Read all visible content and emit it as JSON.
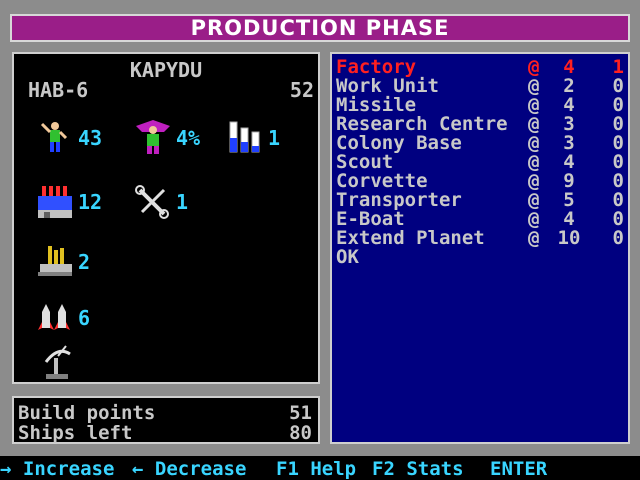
{
  "title": "PRODUCTION PHASE",
  "planet": {
    "name": "KAPYDU",
    "hab": "HAB-6",
    "population": "52",
    "workers": "43",
    "tax": "4%",
    "industry": "1",
    "factories": "12",
    "tools": "1",
    "missiles": "2",
    "ships": "6"
  },
  "summary": {
    "build_points_label": "Build points",
    "build_points": "51",
    "ships_left_label": "Ships left",
    "ships_left": "80"
  },
  "production_list": [
    {
      "name": "Factory",
      "at": "@",
      "cost": "4",
      "qty": "1",
      "selected": true
    },
    {
      "name": "Work Unit",
      "at": "@",
      "cost": "2",
      "qty": "0"
    },
    {
      "name": "Missile",
      "at": "@",
      "cost": "4",
      "qty": "0"
    },
    {
      "name": "Research Centre",
      "at": "@",
      "cost": "3",
      "qty": "0"
    },
    {
      "name": "Colony Base",
      "at": "@",
      "cost": "3",
      "qty": "0"
    },
    {
      "name": "Scout",
      "at": "@",
      "cost": "4",
      "qty": "0"
    },
    {
      "name": "Corvette",
      "at": "@",
      "cost": "9",
      "qty": "0"
    },
    {
      "name": "Transporter",
      "at": "@",
      "cost": "5",
      "qty": "0"
    },
    {
      "name": "E-Boat",
      "at": "@",
      "cost": "4",
      "qty": "0"
    },
    {
      "name": "Extend Planet",
      "at": "@",
      "cost": "10",
      "qty": "0"
    },
    {
      "name": "OK",
      "at": "",
      "cost": "",
      "qty": ""
    }
  ],
  "statusbar": {
    "increase": "→ Increase",
    "decrease": "← Decrease",
    "help": "F1 Help",
    "stats": "F2 Stats",
    "enter": "ENTER"
  },
  "colors": {
    "title_bg": "#9a1e88",
    "list_bg": "#000080",
    "selected_text": "#ff2020",
    "value_text": "#39d5ff"
  },
  "icons": {
    "workers": "worker-icon",
    "tax": "tax-figure-icon",
    "industry": "bar-gauge-icon",
    "factories": "factory-icon",
    "tools": "tools-icon",
    "missiles": "missile-launcher-icon",
    "ships": "rocket-icon",
    "radar": "radar-dish-icon"
  }
}
